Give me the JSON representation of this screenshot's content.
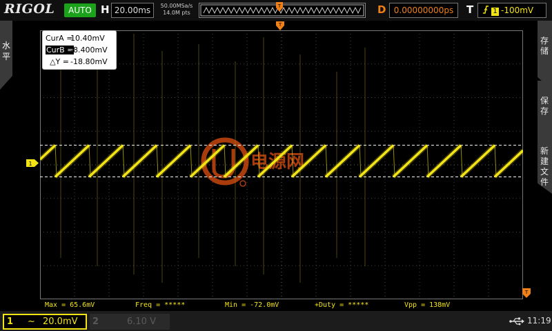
{
  "brand": "RIGOL",
  "acquisition": {
    "mode": "AUTO",
    "h_label": "H",
    "timebase": "20.00ms",
    "sample_rate": "50.00MSa/s",
    "memory_depth": "14.0M pts"
  },
  "delay": {
    "label": "D",
    "value": "0.00000000ps"
  },
  "trigger": {
    "label": "T",
    "source": "1",
    "level": "-100mV",
    "edge": "rising-edge-icon"
  },
  "left_menu": {
    "label": "水平"
  },
  "right_menu": {
    "items": [
      {
        "label": "存储"
      },
      {
        "label": "保存"
      },
      {
        "label": "新建文件"
      }
    ]
  },
  "cursor_panel": {
    "cur_a_label": "CurA =",
    "cur_a_value": "10.40mV",
    "cur_b_label": "CurB =",
    "cur_b_value": "-8.400mV",
    "delta_label": "△Y =",
    "delta_value": "-18.80mV"
  },
  "channel_marker": "1",
  "measurements": [
    {
      "text": "Max = 65.6mV"
    },
    {
      "text": "Freq = *****"
    },
    {
      "text": "Min = -72.0mV"
    },
    {
      "text": "+Duty = *****"
    },
    {
      "text": "Vpp = 138mV"
    }
  ],
  "channels": {
    "ch1": {
      "number": "1",
      "coupling": "~",
      "scale": "20.0mV"
    },
    "ch2": {
      "number": "2",
      "scale": "6.10 V"
    }
  },
  "status": {
    "time": "11:19",
    "usb_icon": "usb-icon"
  },
  "colors": {
    "ch1": "#f3e515",
    "auto_badge": "#1aa31a",
    "trigger_orange": "#f08018",
    "watermark": "#e05010"
  },
  "watermark": {
    "text": "电源网"
  },
  "waveform": {
    "type": "sawtooth",
    "period_divisions": 0.98,
    "low_level_mV": -8.4,
    "high_level_mV": 10.4,
    "spike_count": 10
  }
}
